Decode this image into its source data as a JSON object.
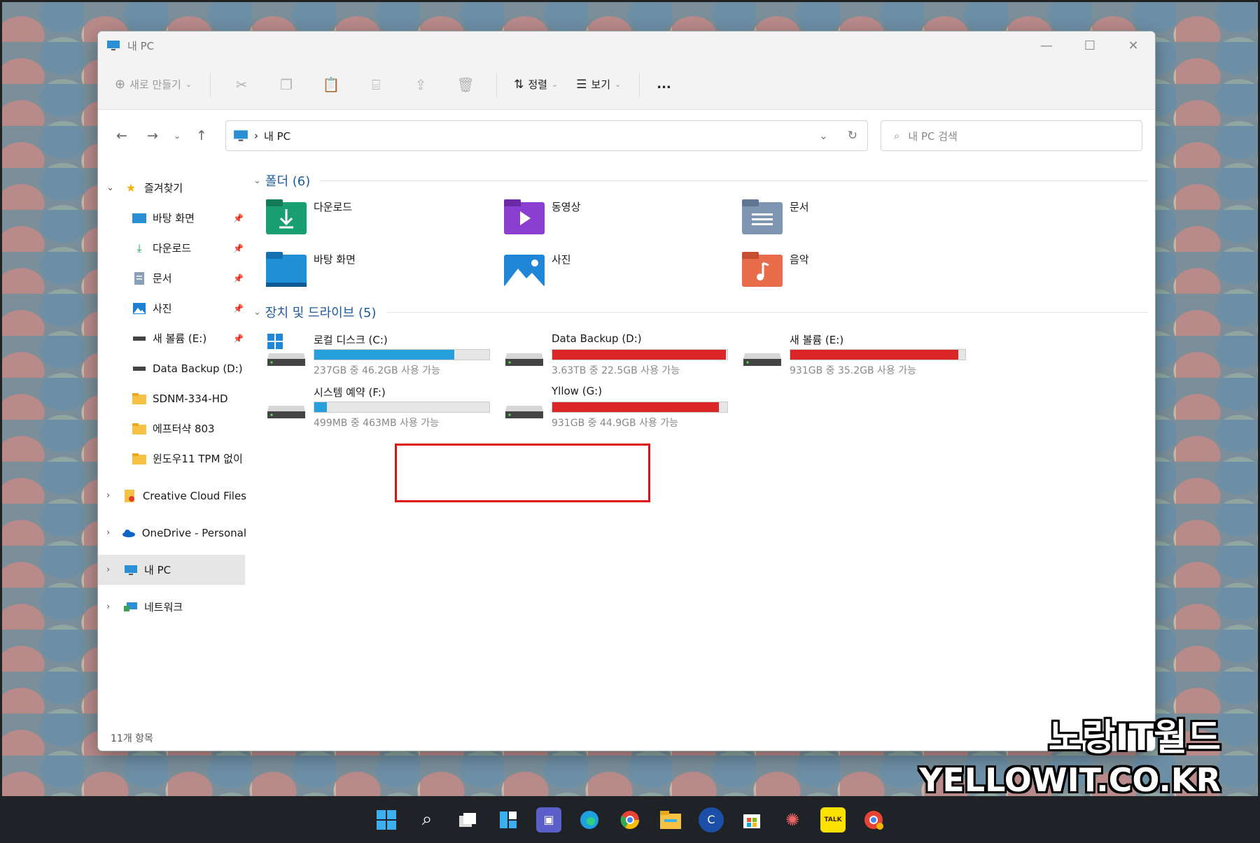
{
  "window": {
    "title": "내 PC"
  },
  "toolbar": {
    "new_label": "새로 만들기",
    "sort_label": "정렬",
    "view_label": "보기",
    "more_label": "..."
  },
  "address": {
    "path_label": "내 PC",
    "search_placeholder": "내 PC 검색"
  },
  "sidebar": {
    "quick_access": "즐겨찾기",
    "pinned": [
      {
        "label": "바탕 화면"
      },
      {
        "label": "다운로드"
      },
      {
        "label": "문서"
      },
      {
        "label": "사진"
      },
      {
        "label": "새 볼륨 (E:)"
      },
      {
        "label": "Data Backup (D:)"
      },
      {
        "label": "SDNM-334-HD"
      },
      {
        "label": "에프터샥 803"
      },
      {
        "label": "윈도우11 TPM 없이"
      }
    ],
    "creative_cloud": "Creative Cloud Files",
    "onedrive": "OneDrive - Personal",
    "this_pc": "내 PC",
    "network": "네트워크"
  },
  "folders": {
    "header": "폴더 (6)",
    "items": [
      {
        "label": "다운로드"
      },
      {
        "label": "동영상"
      },
      {
        "label": "문서"
      },
      {
        "label": "바탕 화면"
      },
      {
        "label": "사진"
      },
      {
        "label": "음악"
      }
    ]
  },
  "drives": {
    "header": "장치 및 드라이브 (5)",
    "items": [
      {
        "label": "로컬 디스크 (C:)",
        "capacity": "237GB 중 46.2GB 사용 가능",
        "used_fraction": 0.8,
        "color": "#26a0da"
      },
      {
        "label": "Data Backup (D:)",
        "capacity": "3.63TB 중 22.5GB 사용 가능",
        "used_fraction": 0.99,
        "color": "#da2626"
      },
      {
        "label": "새 볼륨 (E:)",
        "capacity": "931GB 중 35.2GB 사용 가능",
        "used_fraction": 0.96,
        "color": "#da2626"
      },
      {
        "label": "시스템 예약 (F:)",
        "capacity": "499MB 중 463MB 사용 가능",
        "used_fraction": 0.07,
        "color": "#26a0da"
      },
      {
        "label": "Yllow (G:)",
        "capacity": "931GB 중 44.9GB 사용 가능",
        "used_fraction": 0.95,
        "color": "#da2626"
      }
    ]
  },
  "status": {
    "items_count": "11개 항목"
  },
  "watermark": {
    "line1": "노랑IT월드",
    "line2": "YELLOWIT.CO.KR"
  }
}
